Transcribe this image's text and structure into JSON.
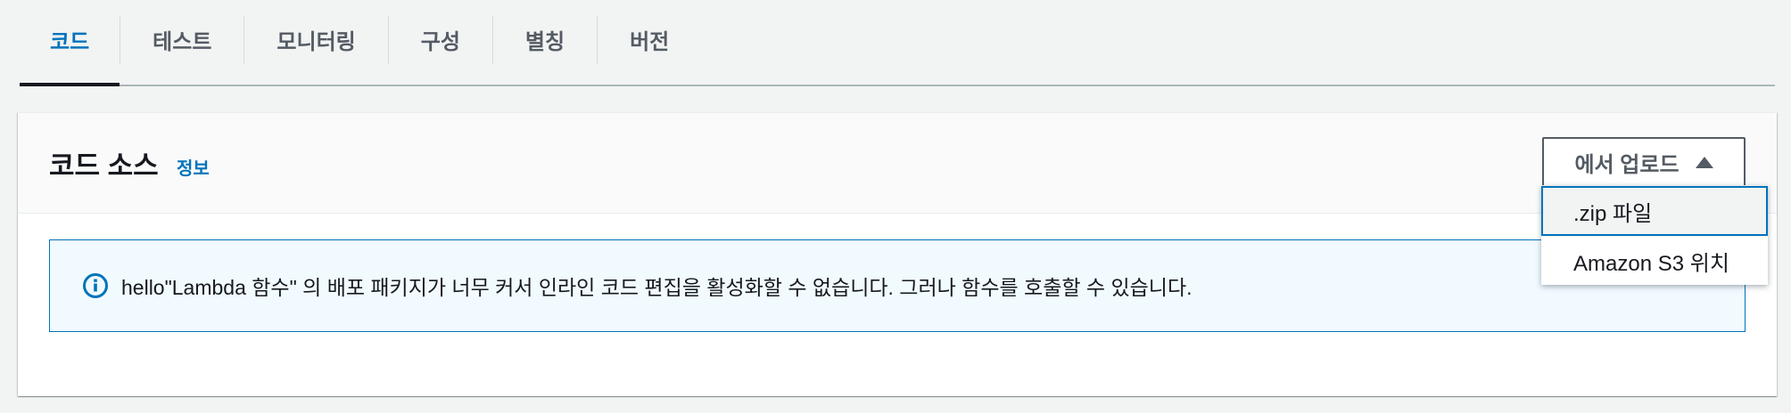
{
  "tabs": [
    {
      "label": "코드",
      "active": true
    },
    {
      "label": "테스트",
      "active": false
    },
    {
      "label": "모니터링",
      "active": false
    },
    {
      "label": "구성",
      "active": false
    },
    {
      "label": "별칭",
      "active": false
    },
    {
      "label": "버전",
      "active": false
    }
  ],
  "panel": {
    "title": "코드 소스",
    "info_link": "정보",
    "upload_button": {
      "label": "에서 업로드",
      "icon": "caret-up-icon",
      "expanded": true
    },
    "alert": {
      "icon": "info-icon",
      "type": "info",
      "message": "hello\"Lambda 함수\" 의 배포 패키지가 너무 커서 인라인 코드 편집을 활성화할 수 없습니다. 그러나 함수를 호출할 수 있습니다."
    },
    "upload_menu": {
      "items": [
        {
          "label": ".zip 파일",
          "focused": true
        },
        {
          "label": "Amazon S3 위치",
          "focused": false
        }
      ]
    }
  },
  "colors": {
    "accent": "#0073bb",
    "text": "#16191f",
    "muted_text": "#545b64",
    "background": "#f2f3f3",
    "alert_background": "#f1faff"
  }
}
